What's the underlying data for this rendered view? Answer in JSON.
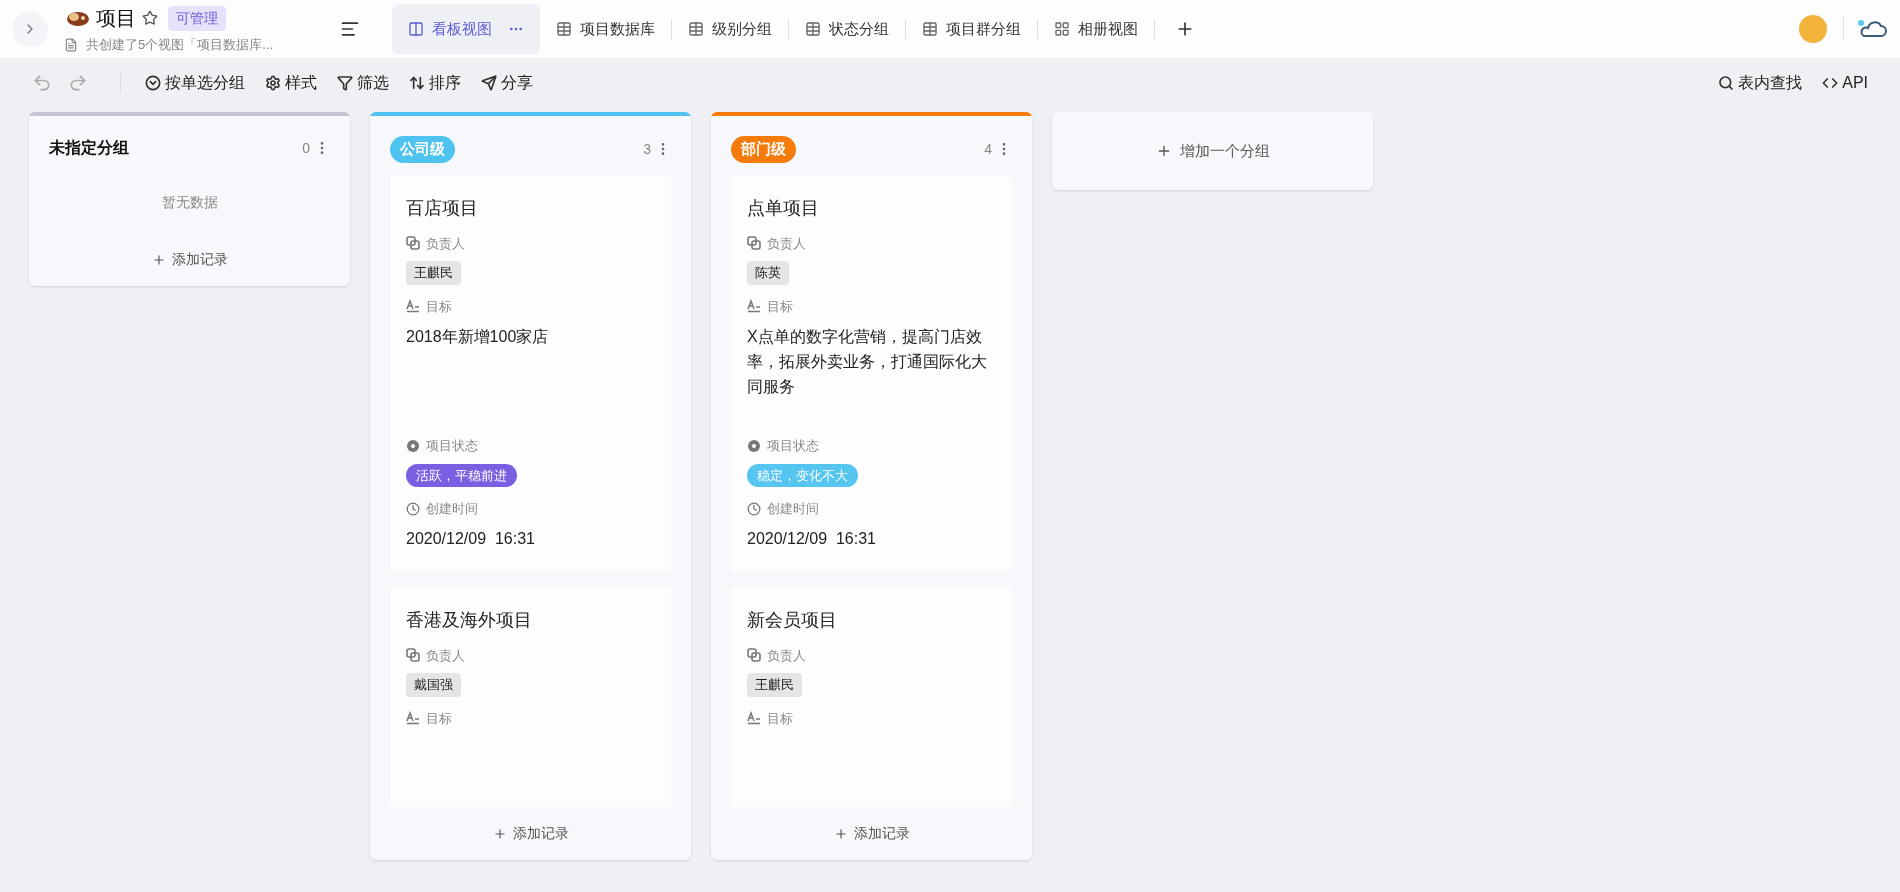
{
  "header": {
    "title": "项目",
    "badge": "可管理",
    "subtitle": "共创建了5个视图「项目数据库...",
    "tabs": [
      {
        "label": "看板视图",
        "kind": "kanban",
        "selected": true
      },
      {
        "label": "项目数据库",
        "kind": "table",
        "selected": false
      },
      {
        "label": "级别分组",
        "kind": "table",
        "selected": false
      },
      {
        "label": "状态分组",
        "kind": "table",
        "selected": false
      },
      {
        "label": "项目群分组",
        "kind": "table",
        "selected": false
      },
      {
        "label": "相册视图",
        "kind": "gallery",
        "selected": false
      }
    ]
  },
  "toolbar": {
    "left": [
      {
        "label": "按单选分组",
        "kind": "group"
      },
      {
        "label": "样式",
        "kind": "style"
      },
      {
        "label": "筛选",
        "kind": "filter"
      },
      {
        "label": "排序",
        "kind": "sort"
      },
      {
        "label": "分享",
        "kind": "share"
      }
    ],
    "right": [
      {
        "label": "表内查找",
        "kind": "search"
      },
      {
        "label": "API",
        "kind": "api"
      }
    ]
  },
  "columns": [
    {
      "name": "未指定分组",
      "kind": "plain",
      "color": "#c3c5d6",
      "count": "0",
      "empty": "暂无数据",
      "add": "添加记录"
    },
    {
      "name": "公司级",
      "kind": "tag",
      "color": "#4fc3f0",
      "count": "3",
      "add": "添加记录",
      "cards": [
        {
          "title": "百店项目",
          "fields": [
            {
              "kind": "person",
              "label": "负责人",
              "value": "王麒民"
            },
            {
              "kind": "text",
              "label": "目标",
              "value": "2018年新增100家店"
            },
            {
              "kind": "status",
              "label": "项目状态",
              "value": "活跃，平稳前进",
              "color": "#7b5fe3"
            },
            {
              "kind": "time",
              "label": "创建时间",
              "value": "2020/12/09  16:31"
            }
          ]
        },
        {
          "title": "香港及海外项目",
          "fields": [
            {
              "kind": "person",
              "label": "负责人",
              "value": "戴国强"
            },
            {
              "kind": "text",
              "label": "目标"
            }
          ]
        }
      ]
    },
    {
      "name": "部门级",
      "kind": "tag",
      "color": "#f57b0c",
      "count": "4",
      "add": "添加记录",
      "cards": [
        {
          "title": "点单项目",
          "fields": [
            {
              "kind": "person",
              "label": "负责人",
              "value": "陈英"
            },
            {
              "kind": "text",
              "label": "目标",
              "value": "X点单的数字化营销，提高门店效率，拓展外卖业务，打通国际化大同服务"
            },
            {
              "kind": "status",
              "label": "项目状态",
              "value": "稳定，变化不大",
              "color": "#56c5f0"
            },
            {
              "kind": "time",
              "label": "创建时间",
              "value": "2020/12/09  16:31"
            }
          ]
        },
        {
          "title": "新会员项目",
          "fields": [
            {
              "kind": "person",
              "label": "负责人",
              "value": "王麒民"
            },
            {
              "kind": "text",
              "label": "目标"
            }
          ]
        }
      ]
    }
  ],
  "add_group": "增加一个分组"
}
